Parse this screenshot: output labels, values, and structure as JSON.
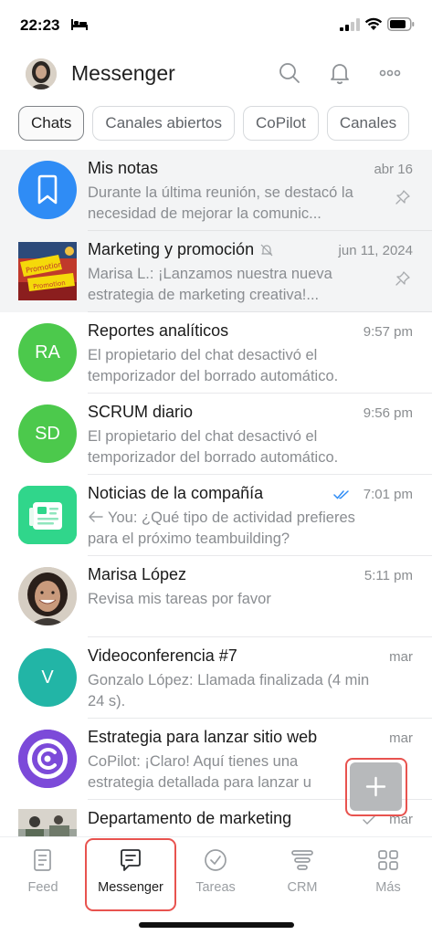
{
  "status_bar": {
    "time": "22:23"
  },
  "header": {
    "title": "Messenger"
  },
  "chips": [
    {
      "label": "Chats",
      "active": true
    },
    {
      "label": "Canales abiertos"
    },
    {
      "label": "CoPilot"
    },
    {
      "label": "Canales"
    }
  ],
  "chats": [
    {
      "title": "Mis notas",
      "time": "abr 16",
      "message": "Durante la última reunión, se destacó la necesidad de mejorar la comunic...",
      "avatar_color": "#2f8cf5",
      "icon": "bookmark-icon"
    },
    {
      "title": "Marketing y promoción",
      "time": "jun 11, 2024",
      "message": "Marisa L.: ¡Lanzamos nuestra nueva estrategia de marketing creativa!...",
      "icon": "promotion-image"
    },
    {
      "title": "Reportes analíticos",
      "time": "9:57 pm",
      "message": "El propietario del chat desactivó el temporizador del borrado automático.",
      "initials": "RA",
      "avatar_color": "#4cc94c"
    },
    {
      "title": "SCRUM diario",
      "time": "9:56 pm",
      "message": "El propietario del chat desactivó el temporizador del borrado automático.",
      "initials": "SD",
      "avatar_color": "#4cc94c"
    },
    {
      "title": "Noticias de la compañía",
      "time": "7:01 pm",
      "message": "You: ¿Qué tipo de actividad prefieres para el próximo teambuilding?",
      "avatar_color": "#30d68b",
      "icon": "news-icon"
    },
    {
      "title": "Marisa López",
      "time": "5:11 pm",
      "message": "Revisa mis tareas por favor",
      "icon": "person-photo"
    },
    {
      "title": "Videoconferencia #7",
      "time": "mar",
      "message": "Gonzalo López: Llamada finalizada (4 min 24 s).",
      "initials": "V",
      "avatar_color": "#22b5a6"
    },
    {
      "title": "Estrategia para lanzar sitio web",
      "time": "mar",
      "message": "CoPilot: ¡Claro! Aquí tienes una estrategia detallada para lanzar u",
      "avatar_color": "#7c4ad9",
      "icon": "copilot-icon"
    },
    {
      "title": "Departamento de marketing",
      "time": "mar",
      "message": "",
      "icon": "group-photo"
    }
  ],
  "tabs": [
    {
      "label": "Feed",
      "icon": "feed-icon"
    },
    {
      "label": "Messenger",
      "icon": "chat-bubble-icon",
      "active": true
    },
    {
      "label": "Tareas",
      "icon": "check-circle-icon"
    },
    {
      "label": "CRM",
      "icon": "crm-filter-icon"
    },
    {
      "label": "Más",
      "icon": "grid-icon"
    }
  ],
  "colors": {
    "accent_red": "#e8534f",
    "blue": "#2f8cf5",
    "green": "#4cc94c"
  }
}
